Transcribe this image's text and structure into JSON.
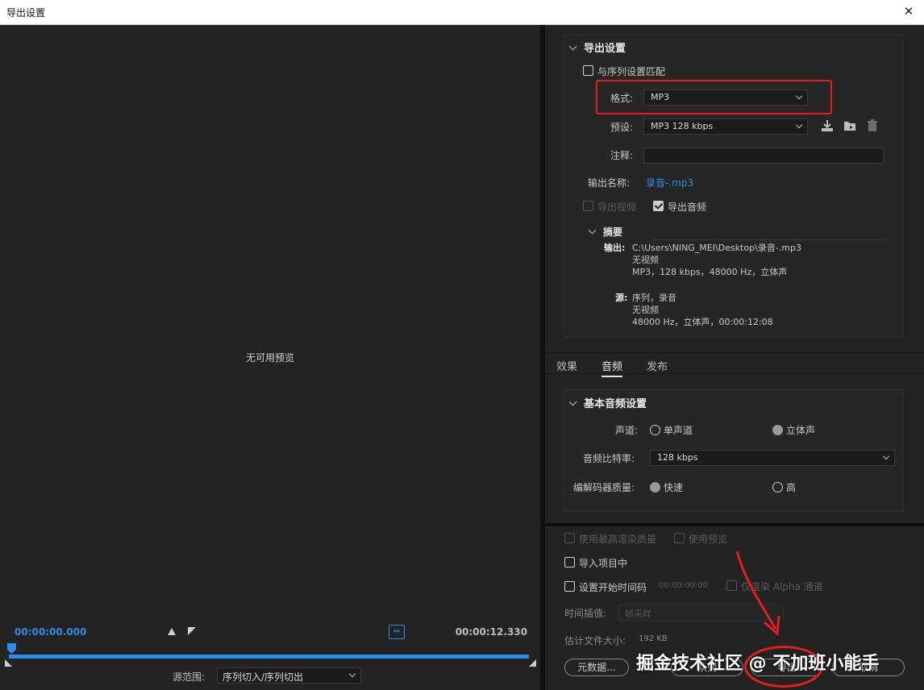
{
  "window": {
    "title": "导出设置",
    "close_label": "✕"
  },
  "preview": {
    "no_preview_text": "无可用预览",
    "timecode_start": "00:00:00.000",
    "timecode_end": "00:00:12.330",
    "source_range_label": "源范围:",
    "source_range_value": "序列切入/序列切出"
  },
  "export_settings": {
    "header": "导出设置",
    "match_sequence_label": "与序列设置匹配",
    "format_label": "格式:",
    "format_value": "MP3",
    "preset_label": "预设:",
    "preset_value": "MP3 128 kbps",
    "comment_label": "注释:",
    "comment_value": "",
    "output_name_label": "输出名称:",
    "output_name_value": "录音-.mp3",
    "export_video_label": "导出视频",
    "export_audio_label": "导出音频",
    "summary_header": "摘要",
    "output_label": "输出:",
    "output_path": "C:\\Users\\NING_MEI\\Desktop\\录音-.mp3",
    "output_line2": "无视频",
    "output_line3": "MP3，128 kbps，48000 Hz，立体声",
    "source_label": "源:",
    "source_line1": "序列，录音",
    "source_line2": "无视频",
    "source_line3": "48000 Hz，立体声，00:00:12:08"
  },
  "tabs": [
    "效果",
    "音频",
    "发布"
  ],
  "audio": {
    "header": "基本音频设置",
    "channels_label": "声道:",
    "mono_label": "单声道",
    "stereo_label": "立体声",
    "bitrate_label": "音频比特率:",
    "bitrate_value": "128 kbps",
    "codec_quality_label": "编解码器质量:",
    "fast_label": "快速",
    "high_label": "高"
  },
  "bottom": {
    "max_render_label": "使用最高渲染质量",
    "use_preview_label": "使用预览",
    "import_project_label": "导入项目中",
    "set_start_tc_label": "设置开始时间码",
    "start_tc_value": "00:00:00:00",
    "alpha_label": "仅渲染 Alpha 通道",
    "time_interp_label": "时间插值:",
    "time_interp_value": "帧采样",
    "est_size_label": "估计文件大小:",
    "est_size_value": "192 KB",
    "metadata_button": "元数据...",
    "queue_button": "队列",
    "export_button": "导出",
    "cancel_button": "取消"
  },
  "overlay": {
    "watermark": "掘金技术社区 @ 不加班小能手",
    "accent": "#e21f1f"
  }
}
